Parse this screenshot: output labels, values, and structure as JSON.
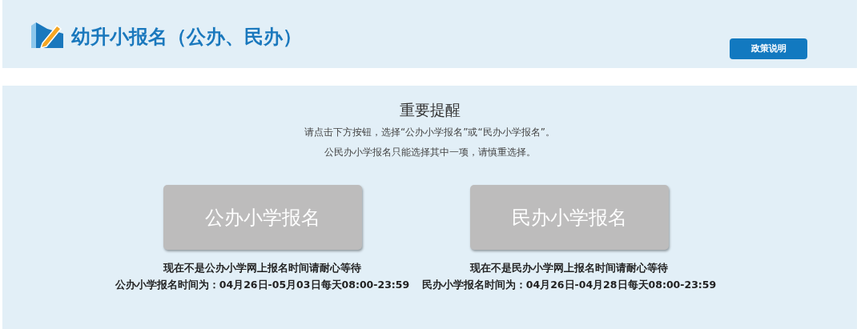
{
  "header": {
    "title": "幼升小报名（公办、民办）",
    "policy_button": "政策说明"
  },
  "notice": {
    "title": "重要提醒",
    "lines": [
      "请点击下方按钮，选择“公办小学报名”或“民办小学报名”。",
      "公民办小学报名只能选择其中一项，请慎重选择。"
    ]
  },
  "options": [
    {
      "label": "公办小学报名",
      "disabled": true,
      "status": "现在不是公办小学网上报名时间请耐心等待",
      "schedule": "公办小学报名时间为：04月26日-05月03日每天08:00-23:59"
    },
    {
      "label": "民办小学报名",
      "disabled": true,
      "status": "现在不是民办小学网上报名时间请耐心等待",
      "schedule": "民办小学报名时间为：04月26日-04月28日每天08:00-23:59"
    }
  ]
}
